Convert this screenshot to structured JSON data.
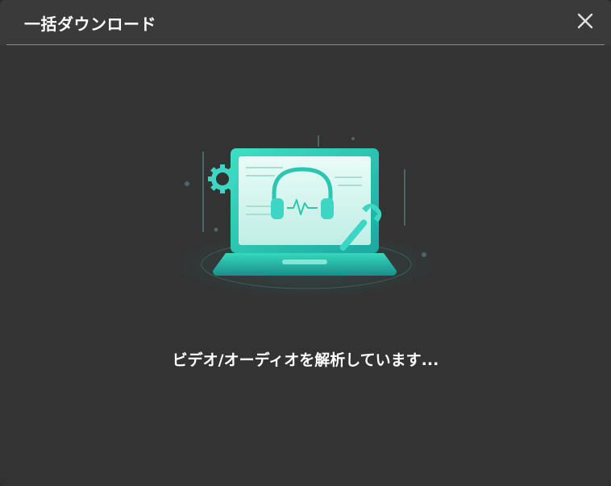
{
  "window": {
    "title": "一括ダウンロード",
    "close_icon": "close-icon"
  },
  "main": {
    "illustration_icon": "laptop-headphones-repair-illustration",
    "status_text": "ビデオ/オーディオを解析しています..."
  },
  "colors": {
    "background": "#333333",
    "titlebar": "#3a3a3a",
    "accent": "#2ad4b4",
    "text": "#ffffff"
  }
}
